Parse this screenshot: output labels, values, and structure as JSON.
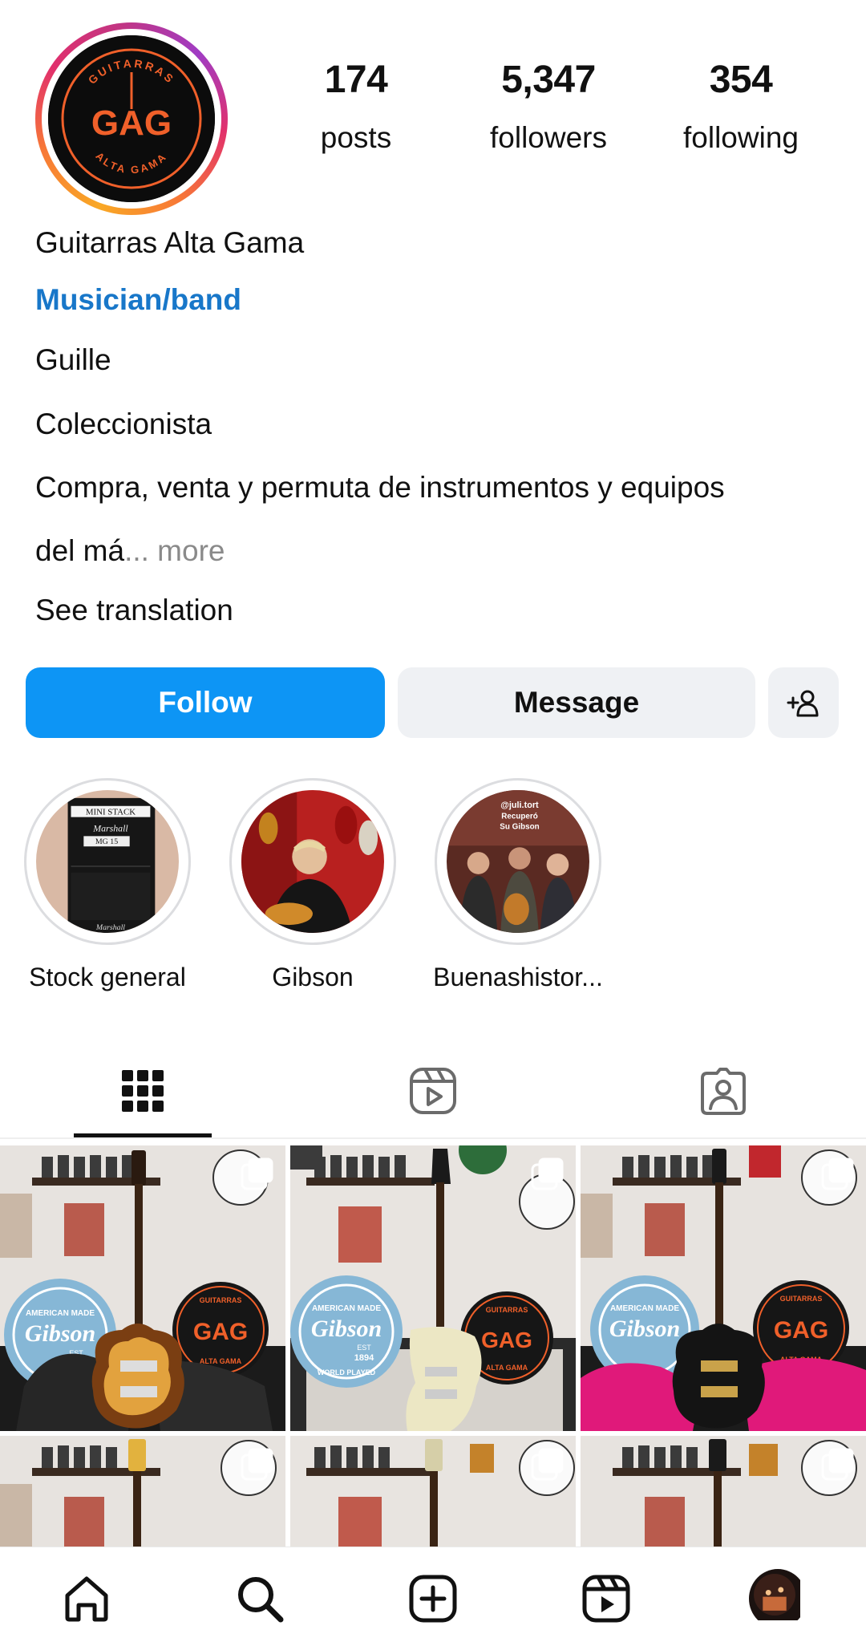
{
  "profile": {
    "logo_text": {
      "top": "GUITARRAS",
      "center": "GAG",
      "bottom": "ALTA GAMA"
    },
    "stats": [
      {
        "value": "174",
        "label": "posts"
      },
      {
        "value": "5,347",
        "label": "followers"
      },
      {
        "value": "354",
        "label": "following"
      }
    ],
    "name": "Guitarras Alta Gama",
    "category": "Musician/band",
    "bio_lines": [
      "Guille",
      "Coleccionista",
      "Compra, venta  y permuta de instrumentos y equipos",
      "del má"
    ],
    "more_label": "... more",
    "see_translation": "See translation"
  },
  "actions": {
    "follow": "Follow",
    "message": "Message",
    "add_user_icon": "person-plus-icon"
  },
  "highlights": [
    {
      "label": "Stock general",
      "image_text": [
        "MINI STACK",
        "Marshall",
        "MG 15",
        "Marshall"
      ]
    },
    {
      "label": "Gibson"
    },
    {
      "label": "Buenashistor...",
      "image_text": [
        "@juli.tort",
        "Recuperó",
        "Su Gibson"
      ]
    }
  ],
  "tabs": [
    {
      "name": "posts-grid",
      "icon": "grid-icon",
      "active": true
    },
    {
      "name": "reels",
      "icon": "reels-icon",
      "active": false
    },
    {
      "name": "tagged",
      "icon": "tagged-person-icon",
      "active": false
    }
  ],
  "posts": [
    {
      "guitar": "sunburst Les Paul",
      "case_color": "#1f1f1f",
      "multi": true,
      "gibson_sign": [
        "AMERICAN MADE",
        "Gibson",
        "EST",
        "1894"
      ],
      "badge": [
        "GUITARRAS",
        "GAG",
        "ALTA GAMA"
      ]
    },
    {
      "guitar": "white Firebird",
      "case_color": "#d9d6d2",
      "multi": true,
      "gibson_sign": [
        "AMERICAN MADE",
        "Gibson",
        "EST",
        "1894",
        "WORLD PLAYED"
      ],
      "badge": [
        "GUITARRAS",
        "GAG",
        "ALTA GAMA"
      ]
    },
    {
      "guitar": "black Les Paul",
      "case_color": "#e0197a",
      "multi": true,
      "gibson_sign": [
        "AMERICAN MADE",
        "Gibson"
      ],
      "badge": [
        "GUITARRAS",
        "GAG",
        "ALTA GAMA"
      ]
    },
    {
      "multi": true
    },
    {
      "multi": true
    },
    {
      "multi": true
    }
  ],
  "bottom_nav": [
    {
      "name": "home",
      "icon": "home-icon"
    },
    {
      "name": "search",
      "icon": "search-icon"
    },
    {
      "name": "create",
      "icon": "plus-square-icon"
    },
    {
      "name": "reels",
      "icon": "reels-icon"
    },
    {
      "name": "profile",
      "icon": "profile-avatar"
    }
  ],
  "colors": {
    "follow_button": "#0d95f5",
    "category_link": "#1877c9",
    "secondary_button": "#eff1f4",
    "logo_orange": "#f0602a"
  }
}
